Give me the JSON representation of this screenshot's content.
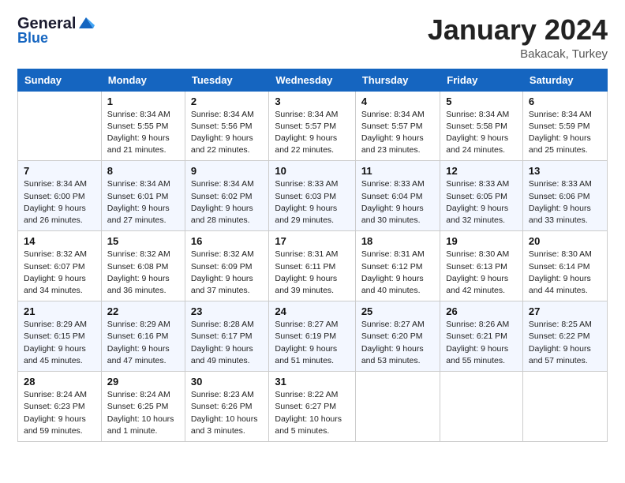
{
  "logo": {
    "line1": "General",
    "line2": "Blue"
  },
  "title": "January 2024",
  "location": "Bakacak, Turkey",
  "days_header": [
    "Sunday",
    "Monday",
    "Tuesday",
    "Wednesday",
    "Thursday",
    "Friday",
    "Saturday"
  ],
  "weeks": [
    [
      {
        "day": "",
        "sunrise": "",
        "sunset": "",
        "daylight": ""
      },
      {
        "day": "1",
        "sunrise": "Sunrise: 8:34 AM",
        "sunset": "Sunset: 5:55 PM",
        "daylight": "Daylight: 9 hours and 21 minutes."
      },
      {
        "day": "2",
        "sunrise": "Sunrise: 8:34 AM",
        "sunset": "Sunset: 5:56 PM",
        "daylight": "Daylight: 9 hours and 22 minutes."
      },
      {
        "day": "3",
        "sunrise": "Sunrise: 8:34 AM",
        "sunset": "Sunset: 5:57 PM",
        "daylight": "Daylight: 9 hours and 22 minutes."
      },
      {
        "day": "4",
        "sunrise": "Sunrise: 8:34 AM",
        "sunset": "Sunset: 5:57 PM",
        "daylight": "Daylight: 9 hours and 23 minutes."
      },
      {
        "day": "5",
        "sunrise": "Sunrise: 8:34 AM",
        "sunset": "Sunset: 5:58 PM",
        "daylight": "Daylight: 9 hours and 24 minutes."
      },
      {
        "day": "6",
        "sunrise": "Sunrise: 8:34 AM",
        "sunset": "Sunset: 5:59 PM",
        "daylight": "Daylight: 9 hours and 25 minutes."
      }
    ],
    [
      {
        "day": "7",
        "sunrise": "Sunrise: 8:34 AM",
        "sunset": "Sunset: 6:00 PM",
        "daylight": "Daylight: 9 hours and 26 minutes."
      },
      {
        "day": "8",
        "sunrise": "Sunrise: 8:34 AM",
        "sunset": "Sunset: 6:01 PM",
        "daylight": "Daylight: 9 hours and 27 minutes."
      },
      {
        "day": "9",
        "sunrise": "Sunrise: 8:34 AM",
        "sunset": "Sunset: 6:02 PM",
        "daylight": "Daylight: 9 hours and 28 minutes."
      },
      {
        "day": "10",
        "sunrise": "Sunrise: 8:33 AM",
        "sunset": "Sunset: 6:03 PM",
        "daylight": "Daylight: 9 hours and 29 minutes."
      },
      {
        "day": "11",
        "sunrise": "Sunrise: 8:33 AM",
        "sunset": "Sunset: 6:04 PM",
        "daylight": "Daylight: 9 hours and 30 minutes."
      },
      {
        "day": "12",
        "sunrise": "Sunrise: 8:33 AM",
        "sunset": "Sunset: 6:05 PM",
        "daylight": "Daylight: 9 hours and 32 minutes."
      },
      {
        "day": "13",
        "sunrise": "Sunrise: 8:33 AM",
        "sunset": "Sunset: 6:06 PM",
        "daylight": "Daylight: 9 hours and 33 minutes."
      }
    ],
    [
      {
        "day": "14",
        "sunrise": "Sunrise: 8:32 AM",
        "sunset": "Sunset: 6:07 PM",
        "daylight": "Daylight: 9 hours and 34 minutes."
      },
      {
        "day": "15",
        "sunrise": "Sunrise: 8:32 AM",
        "sunset": "Sunset: 6:08 PM",
        "daylight": "Daylight: 9 hours and 36 minutes."
      },
      {
        "day": "16",
        "sunrise": "Sunrise: 8:32 AM",
        "sunset": "Sunset: 6:09 PM",
        "daylight": "Daylight: 9 hours and 37 minutes."
      },
      {
        "day": "17",
        "sunrise": "Sunrise: 8:31 AM",
        "sunset": "Sunset: 6:11 PM",
        "daylight": "Daylight: 9 hours and 39 minutes."
      },
      {
        "day": "18",
        "sunrise": "Sunrise: 8:31 AM",
        "sunset": "Sunset: 6:12 PM",
        "daylight": "Daylight: 9 hours and 40 minutes."
      },
      {
        "day": "19",
        "sunrise": "Sunrise: 8:30 AM",
        "sunset": "Sunset: 6:13 PM",
        "daylight": "Daylight: 9 hours and 42 minutes."
      },
      {
        "day": "20",
        "sunrise": "Sunrise: 8:30 AM",
        "sunset": "Sunset: 6:14 PM",
        "daylight": "Daylight: 9 hours and 44 minutes."
      }
    ],
    [
      {
        "day": "21",
        "sunrise": "Sunrise: 8:29 AM",
        "sunset": "Sunset: 6:15 PM",
        "daylight": "Daylight: 9 hours and 45 minutes."
      },
      {
        "day": "22",
        "sunrise": "Sunrise: 8:29 AM",
        "sunset": "Sunset: 6:16 PM",
        "daylight": "Daylight: 9 hours and 47 minutes."
      },
      {
        "day": "23",
        "sunrise": "Sunrise: 8:28 AM",
        "sunset": "Sunset: 6:17 PM",
        "daylight": "Daylight: 9 hours and 49 minutes."
      },
      {
        "day": "24",
        "sunrise": "Sunrise: 8:27 AM",
        "sunset": "Sunset: 6:19 PM",
        "daylight": "Daylight: 9 hours and 51 minutes."
      },
      {
        "day": "25",
        "sunrise": "Sunrise: 8:27 AM",
        "sunset": "Sunset: 6:20 PM",
        "daylight": "Daylight: 9 hours and 53 minutes."
      },
      {
        "day": "26",
        "sunrise": "Sunrise: 8:26 AM",
        "sunset": "Sunset: 6:21 PM",
        "daylight": "Daylight: 9 hours and 55 minutes."
      },
      {
        "day": "27",
        "sunrise": "Sunrise: 8:25 AM",
        "sunset": "Sunset: 6:22 PM",
        "daylight": "Daylight: 9 hours and 57 minutes."
      }
    ],
    [
      {
        "day": "28",
        "sunrise": "Sunrise: 8:24 AM",
        "sunset": "Sunset: 6:23 PM",
        "daylight": "Daylight: 9 hours and 59 minutes."
      },
      {
        "day": "29",
        "sunrise": "Sunrise: 8:24 AM",
        "sunset": "Sunset: 6:25 PM",
        "daylight": "Daylight: 10 hours and 1 minute."
      },
      {
        "day": "30",
        "sunrise": "Sunrise: 8:23 AM",
        "sunset": "Sunset: 6:26 PM",
        "daylight": "Daylight: 10 hours and 3 minutes."
      },
      {
        "day": "31",
        "sunrise": "Sunrise: 8:22 AM",
        "sunset": "Sunset: 6:27 PM",
        "daylight": "Daylight: 10 hours and 5 minutes."
      },
      {
        "day": "",
        "sunrise": "",
        "sunset": "",
        "daylight": ""
      },
      {
        "day": "",
        "sunrise": "",
        "sunset": "",
        "daylight": ""
      },
      {
        "day": "",
        "sunrise": "",
        "sunset": "",
        "daylight": ""
      }
    ]
  ]
}
